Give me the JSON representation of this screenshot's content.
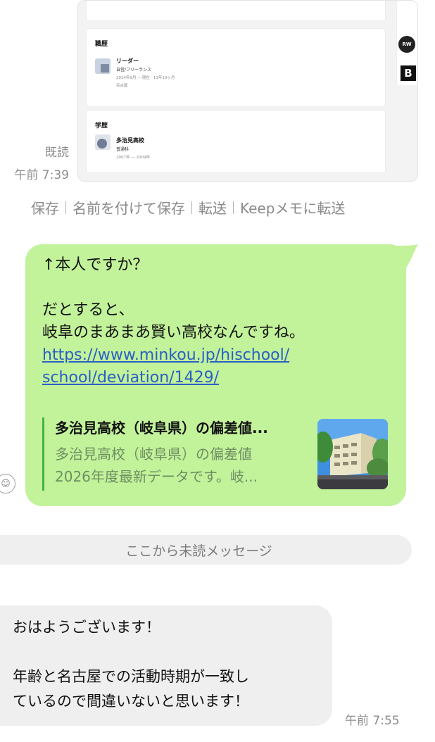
{
  "image_card": {
    "career": {
      "heading": "職歴",
      "title": "リーダー",
      "sub": "自営/フリーランス",
      "period": "2014年9月 ~ 現在 · 11年10ヶ月",
      "location": "名古屋"
    },
    "education": {
      "heading": "学歴",
      "title": "多治見高校",
      "sub": "普通科",
      "period": "2007年 — 2009年"
    },
    "rw_badge": "RW",
    "b_badge": "B"
  },
  "sent_meta": {
    "read": "既読",
    "time": "午前 7:39"
  },
  "image_actions": {
    "save": "保存",
    "save_as": "名前を付けて保存",
    "forward": "転送",
    "keep": "Keepメモに転送"
  },
  "outgoing": {
    "lines": [
      "↑本人ですか？",
      "",
      "だとすると、",
      "岐阜のまあまあ賢い高校なんですね。"
    ],
    "link_lines": [
      "https://www.minkou.jp/hischool/",
      "school/deviation/1429/"
    ],
    "preview": {
      "title": "多治見高校（岐阜県）の偏差値...",
      "desc_1": "多治見高校（岐阜県）の偏差値",
      "desc_2": "2026年度最新データです。岐..."
    }
  },
  "emoji_icon": "☺",
  "unread_divider": "ここから未読メッセージ",
  "incoming": {
    "lines": [
      "おはようございます！",
      "",
      "年齢と名古屋での活動時期が一致し",
      "ているので間違いないと思います！"
    ],
    "time": "午前 7:55"
  },
  "colors": {
    "bubble_out": "#c2f29a",
    "bubble_in": "#efefef",
    "link": "#2a5fc7",
    "preview_bar": "#44b24a"
  }
}
